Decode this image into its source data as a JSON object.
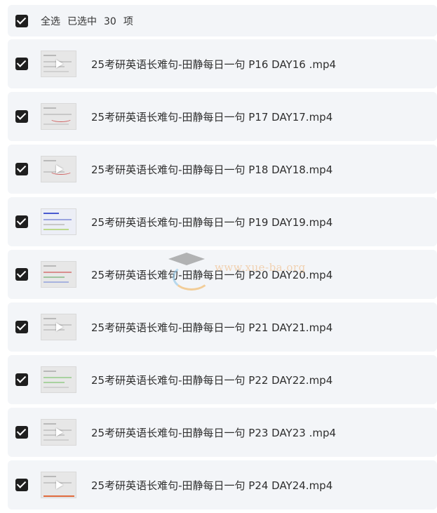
{
  "header": {
    "select_all_label": "全选",
    "selected_prefix": "已选中",
    "selected_count": "30",
    "selected_suffix": "项"
  },
  "files": [
    {
      "name": "25考研英语长难句-田静每日一句 P16 DAY16 .mp4",
      "checked": true,
      "thumb": "plain"
    },
    {
      "name": "25考研英语长难句-田静每日一句 P17 DAY17.mp4",
      "checked": true,
      "thumb": "accent"
    },
    {
      "name": "25考研英语长难句-田静每日一句 P18 DAY18.mp4",
      "checked": true,
      "thumb": "accent"
    },
    {
      "name": "25考研英语长难句-田静每日一句 P19 DAY19.mp4",
      "checked": true,
      "thumb": "blue"
    },
    {
      "name": "25考研英语长难句-田静每日一句 P20 DAY20.mp4",
      "checked": true,
      "thumb": "accent"
    },
    {
      "name": "25考研英语长难句-田静每日一句 P21 DAY21.mp4",
      "checked": true,
      "thumb": "plain"
    },
    {
      "name": "25考研英语长难句-田静每日一句 P22 DAY22.mp4",
      "checked": true,
      "thumb": "green"
    },
    {
      "name": "25考研英语长难句-田静每日一句 P23 DAY23 .mp4",
      "checked": true,
      "thumb": "plain"
    },
    {
      "name": "25考研英语长难句-田静每日一句 P24 DAY24.mp4",
      "checked": true,
      "thumb": "plain"
    }
  ],
  "watermark": {
    "text": "www.xue-ba.org"
  },
  "colors": {
    "row_bg": "#f3f5f8",
    "checkbox": "#1f1f1f",
    "text": "#2f2f2f"
  }
}
